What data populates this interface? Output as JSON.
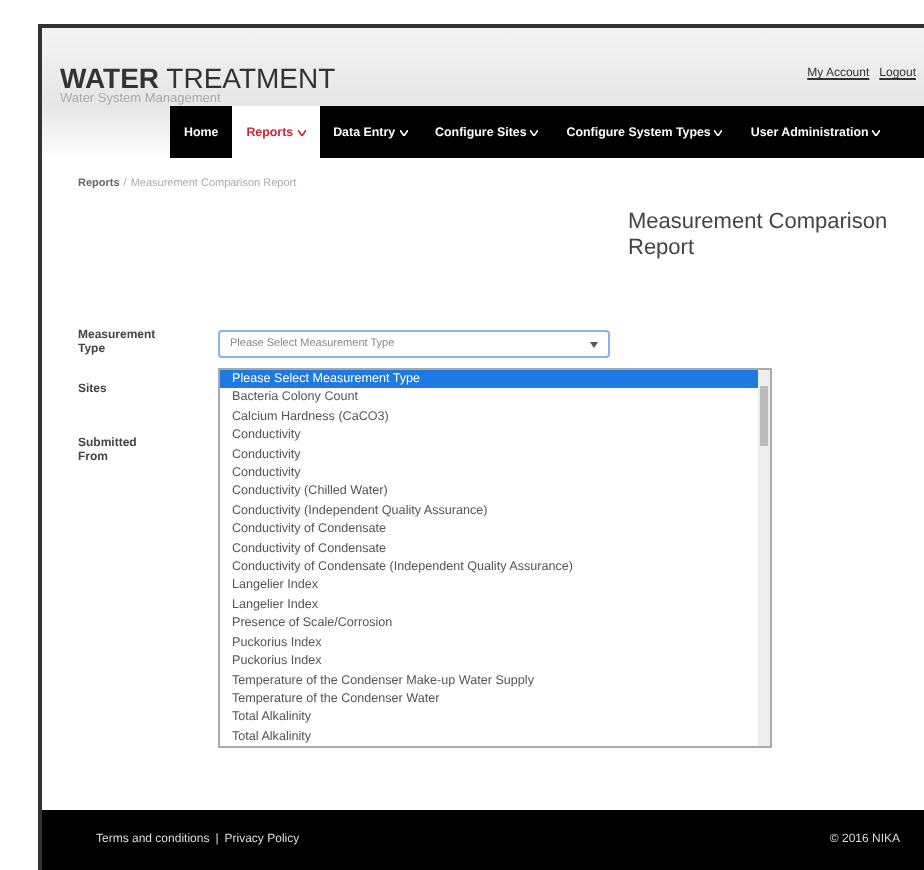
{
  "header": {
    "title_bold": "WATER",
    "title_rest": "TREATMENT",
    "subtitle": "Water System Management",
    "links": [
      "My Account",
      "Logout"
    ]
  },
  "nav": [
    {
      "label": "Home",
      "dropdown": false,
      "selected": false
    },
    {
      "label": "Reports",
      "dropdown": true,
      "selected": true
    },
    {
      "label": "Data Entry",
      "dropdown": true,
      "selected": false
    },
    {
      "label": "Configure Sites",
      "dropdown": true,
      "selected": false
    },
    {
      "label": "Configure System Types",
      "dropdown": true,
      "selected": false
    },
    {
      "label": "User Administration",
      "dropdown": true,
      "selected": false
    }
  ],
  "breadcrumb": {
    "parent": "Reports",
    "separator": "/",
    "current": "Measurement Comparison Report"
  },
  "page_title": "Measurement Comparison Report",
  "form": {
    "fields": [
      {
        "label": "Measurement Type"
      },
      {
        "label": "Sites"
      },
      {
        "label": "Submitted From"
      }
    ]
  },
  "select": {
    "value": "Please Select Measurement Type",
    "expanded": true,
    "options": [
      {
        "label": "Please Select Measurement Type",
        "selected": true
      },
      {
        "label": "Bacteria Colony Count",
        "selected": false
      },
      {
        "label": "Calcium Hardness (CaCO3)",
        "selected": false
      },
      {
        "label": "Conductivity",
        "selected": false
      },
      {
        "label": "Conductivity",
        "selected": false
      },
      {
        "label": "Conductivity",
        "selected": false
      },
      {
        "label": "Conductivity (Chilled Water)",
        "selected": false
      },
      {
        "label": "Conductivity (Independent Quality Assurance)",
        "selected": false
      },
      {
        "label": "Conductivity of Condensate",
        "selected": false
      },
      {
        "label": "Conductivity of Condensate",
        "selected": false
      },
      {
        "label": "Conductivity of Condensate (Independent Quality Assurance)",
        "selected": false
      },
      {
        "label": "Langelier Index",
        "selected": false
      },
      {
        "label": "Langelier Index",
        "selected": false
      },
      {
        "label": "Presence of Scale/Corrosion",
        "selected": false
      },
      {
        "label": "Puckorius Index",
        "selected": false
      },
      {
        "label": "Puckorius Index",
        "selected": false
      },
      {
        "label": "Temperature of the Condenser Make-up Water Supply",
        "selected": false
      },
      {
        "label": "Temperature of the Condenser Water",
        "selected": false
      },
      {
        "label": "Total Alkalinity",
        "selected": false
      },
      {
        "label": "Total Alkalinity",
        "selected": false
      }
    ]
  },
  "footer": {
    "links": [
      "Terms and conditions",
      "Privacy Policy"
    ],
    "separator": "|",
    "copyright": "© 2016 NIKA"
  }
}
